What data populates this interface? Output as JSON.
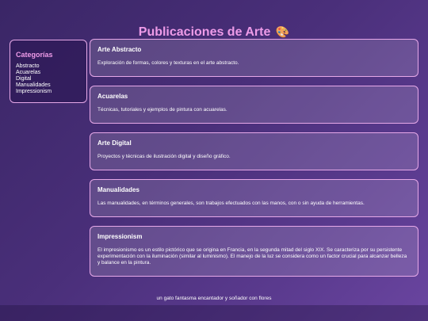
{
  "header": {
    "title": "Publicaciones de Arte",
    "emoji": "🎨"
  },
  "sidebar": {
    "heading": "Categorías",
    "items": [
      {
        "label": "Abstracto"
      },
      {
        "label": "Acuarelas"
      },
      {
        "label": "Digital"
      },
      {
        "label": "Manualidades"
      },
      {
        "label": "Impressionism"
      }
    ]
  },
  "posts": [
    {
      "title": "Arte Abstracto",
      "description": "Exploración de formas, colores y texturas en el arte abstracto."
    },
    {
      "title": "Acuarelas",
      "description": "Técnicas, tutoriales y ejemplos de pintura con acuarelas."
    },
    {
      "title": "Arte Digital",
      "description": "Proyectos y técnicas de ilustración digital y diseño gráfico."
    },
    {
      "title": "Manualidades",
      "description": "Las manualidades, en términos generales, son trabajos efectuados con las manos, con o sin ayuda de herramientas."
    },
    {
      "title": "Impressionism",
      "description": "El impresionismo es un estilo pictórico que se origina en Francia, en la segunda mitad del siglo XIX. Se caracteriza por su persistente experimentación con la iluminación (similar al luminismo). El manejo de la luz se considera como un factor crucial para alcanzar belleza y balance en la pintura."
    }
  ],
  "footer": {
    "text": "un gato fantasma encantador y soñador con flores"
  },
  "colors": {
    "accent": "#ee9be8",
    "border": "#e6a8e8",
    "background_start": "#3a2666",
    "background_end": "#6a45a0"
  }
}
